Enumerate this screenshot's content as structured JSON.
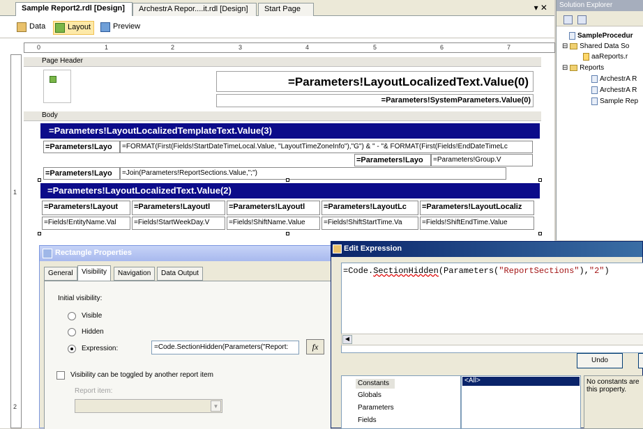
{
  "tabs": {
    "items": [
      "Sample Report2.rdl [Design]",
      "ArchestrA Repor....it.rdl [Design]",
      "Start Page"
    ],
    "controls": "▾ ✕"
  },
  "views": {
    "data": "Data",
    "layout": "Layout",
    "preview": "Preview"
  },
  "ruler": {
    "ticks": [
      "0",
      "1",
      "2",
      "3",
      "4",
      "5",
      "6",
      "7"
    ],
    "vticks": [
      "1",
      "2"
    ]
  },
  "report": {
    "page_header_label": "Page Header",
    "body_label": "Body",
    "title_expr": "=Parameters!LayoutLocalizedText.Value(0)",
    "subtitle_expr": "=Parameters!SystemParameters.Value(0)",
    "band1": "=Parameters!LayoutLocalizedTemplateText.Value(3)",
    "row1_label": "=Parameters!Layo",
    "row1_value": "=FORMAT(First(Fields!StartDateTimeLocal.Value, \"LayoutTimeZoneInfo\"),\"G\") & \" - \"& FORMAT(First(Fields!EndDateTimeLc",
    "row2_label": "=Parameters!Layo",
    "row2_value": "=Parameters!Group.V",
    "row3_label": "=Parameters!Layo",
    "row3_value": "=Join(Parameters!ReportSections.Value,\";\")",
    "band2": "=Parameters!LayoutLocalizedText.Value(2)",
    "headers": [
      "=Parameters!Layout",
      "=Parameters!Layoutl",
      "=Parameters!Layoutl",
      "=Parameters!LayoutLc",
      "=Parameters!LayoutLocaliz"
    ],
    "fields": [
      "=Fields!EntityName.Val",
      "=Fields!StartWeekDay.V",
      "=Fields!ShiftName.Value",
      "=Fields!ShiftStartTime.Va",
      "=Fields!ShiftEndTime.Value"
    ]
  },
  "solution": {
    "title": "Solution Explorer",
    "items": [
      "SampleProcedur",
      "Shared Data So",
      "aaReports.r",
      "Reports",
      "ArchestrA R",
      "ArchestrA R",
      "Sample Rep"
    ]
  },
  "rect_props": {
    "title": "Rectangle Properties",
    "tabs": [
      "General",
      "Visibility",
      "Navigation",
      "Data Output"
    ],
    "initial_visibility": "Initial visibility:",
    "visible": "Visible",
    "hidden": "Hidden",
    "expression": "Expression:",
    "expression_value": "=Code.SectionHidden(Parameters(\"Report:",
    "fx": "fx",
    "toggle_label": "Visibility can be toggled by another report item",
    "report_item": "Report item:"
  },
  "edit_expr": {
    "title": "Edit Expression",
    "code_prefix": "=Code.",
    "code_fn": "SectionHidden",
    "code_mid": "(Parameters(",
    "code_str1": "\"ReportSections\"",
    "code_comma": "),",
    "code_str2": "\"2\"",
    "code_end": ")",
    "undo": "Undo",
    "categories": [
      "Constants",
      "Globals",
      "Parameters",
      "Fields"
    ],
    "items": [
      "<All>"
    ],
    "description": "No constants are this property."
  }
}
